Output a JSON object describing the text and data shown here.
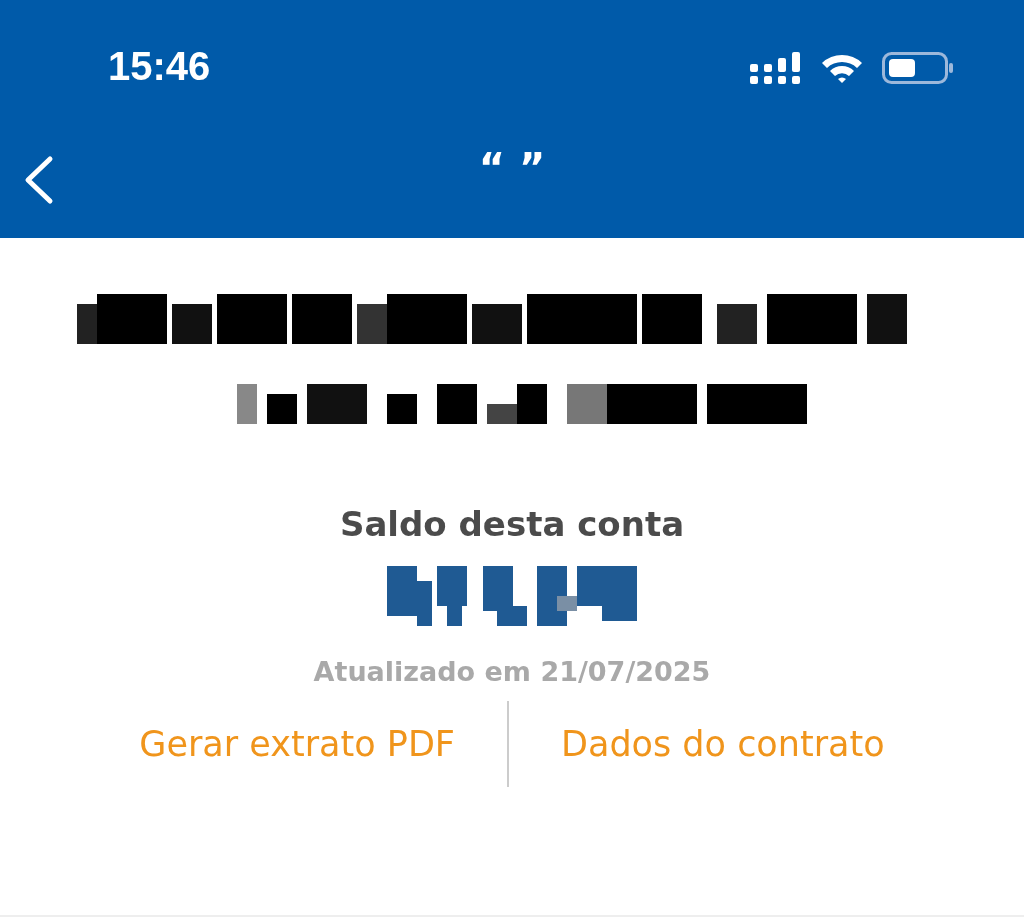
{
  "status_bar": {
    "time": "15:46"
  },
  "nav": {
    "title": "“ ”"
  },
  "balance": {
    "label": "Saldo desta conta",
    "updated": "Atualizado em 21/07/2025"
  },
  "actions": [
    {
      "label": "Gerar extrato PDF"
    },
    {
      "label": "Dados do contrato"
    }
  ]
}
